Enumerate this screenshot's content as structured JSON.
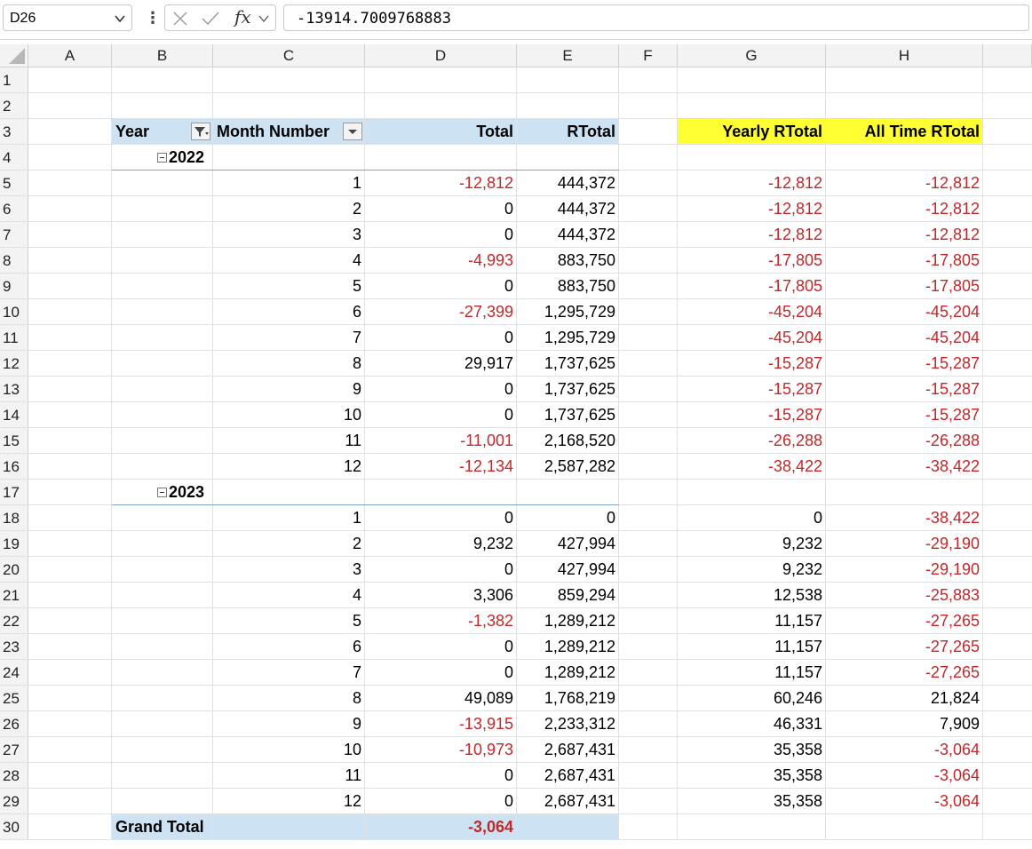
{
  "formula_bar": {
    "cell_ref": "D26",
    "formula": "-13914.7009768883",
    "more_icon": "vertical-ellipsis",
    "cancel_icon": "x-icon",
    "confirm_icon": "check-icon",
    "fx_label": "fx"
  },
  "columns": [
    "A",
    "B",
    "C",
    "D",
    "E",
    "F",
    "G",
    "H"
  ],
  "rows": [
    "1",
    "2",
    "3",
    "4",
    "5",
    "6",
    "7",
    "8",
    "9",
    "10",
    "11",
    "12",
    "13",
    "14",
    "15",
    "16",
    "17",
    "18",
    "19",
    "20",
    "21",
    "22",
    "23",
    "24",
    "25",
    "26",
    "27",
    "28",
    "29",
    "30"
  ],
  "pivot": {
    "header_year": "Year",
    "header_month": "Month Number",
    "header_total": "Total",
    "header_rtotal": "RTotal",
    "groups": [
      {
        "year": "2022",
        "rows": [
          {
            "month": "1",
            "total": "-12,812",
            "rtotal": "444,372",
            "neg": true
          },
          {
            "month": "2",
            "total": "0",
            "rtotal": "444,372",
            "neg": false
          },
          {
            "month": "3",
            "total": "0",
            "rtotal": "444,372",
            "neg": false
          },
          {
            "month": "4",
            "total": "-4,993",
            "rtotal": "883,750",
            "neg": true
          },
          {
            "month": "5",
            "total": "0",
            "rtotal": "883,750",
            "neg": false
          },
          {
            "month": "6",
            "total": "-27,399",
            "rtotal": "1,295,729",
            "neg": true
          },
          {
            "month": "7",
            "total": "0",
            "rtotal": "1,295,729",
            "neg": false
          },
          {
            "month": "8",
            "total": "29,917",
            "rtotal": "1,737,625",
            "neg": false
          },
          {
            "month": "9",
            "total": "0",
            "rtotal": "1,737,625",
            "neg": false
          },
          {
            "month": "10",
            "total": "0",
            "rtotal": "1,737,625",
            "neg": false
          },
          {
            "month": "11",
            "total": "-11,001",
            "rtotal": "2,168,520",
            "neg": true
          },
          {
            "month": "12",
            "total": "-12,134",
            "rtotal": "2,587,282",
            "neg": true
          }
        ]
      },
      {
        "year": "2023",
        "rows": [
          {
            "month": "1",
            "total": "0",
            "rtotal": "0",
            "neg": false
          },
          {
            "month": "2",
            "total": "9,232",
            "rtotal": "427,994",
            "neg": false
          },
          {
            "month": "3",
            "total": "0",
            "rtotal": "427,994",
            "neg": false
          },
          {
            "month": "4",
            "total": "3,306",
            "rtotal": "859,294",
            "neg": false
          },
          {
            "month": "5",
            "total": "-1,382",
            "rtotal": "1,289,212",
            "neg": true
          },
          {
            "month": "6",
            "total": "0",
            "rtotal": "1,289,212",
            "neg": false
          },
          {
            "month": "7",
            "total": "0",
            "rtotal": "1,289,212",
            "neg": false
          },
          {
            "month": "8",
            "total": "49,089",
            "rtotal": "1,768,219",
            "neg": false
          },
          {
            "month": "9",
            "total": "-13,915",
            "rtotal": "2,233,312",
            "neg": true
          },
          {
            "month": "10",
            "total": "-10,973",
            "rtotal": "2,687,431",
            "neg": true
          },
          {
            "month": "11",
            "total": "0",
            "rtotal": "2,687,431",
            "neg": false
          },
          {
            "month": "12",
            "total": "0",
            "rtotal": "2,687,431",
            "neg": false
          }
        ]
      }
    ],
    "grand_total_label": "Grand Total",
    "grand_total_value": "-3,064"
  },
  "side_table": {
    "header_yearly": "Yearly RTotal",
    "header_alltime": "All Time RTotal",
    "rows": [
      {
        "row": 5,
        "yearly": "-12,812",
        "alltime": "-12,812"
      },
      {
        "row": 6,
        "yearly": "-12,812",
        "alltime": "-12,812"
      },
      {
        "row": 7,
        "yearly": "-12,812",
        "alltime": "-12,812"
      },
      {
        "row": 8,
        "yearly": "-17,805",
        "alltime": "-17,805"
      },
      {
        "row": 9,
        "yearly": "-17,805",
        "alltime": "-17,805"
      },
      {
        "row": 10,
        "yearly": "-45,204",
        "alltime": "-45,204"
      },
      {
        "row": 11,
        "yearly": "-45,204",
        "alltime": "-45,204"
      },
      {
        "row": 12,
        "yearly": "-15,287",
        "alltime": "-15,287"
      },
      {
        "row": 13,
        "yearly": "-15,287",
        "alltime": "-15,287"
      },
      {
        "row": 14,
        "yearly": "-15,287",
        "alltime": "-15,287"
      },
      {
        "row": 15,
        "yearly": "-26,288",
        "alltime": "-26,288"
      },
      {
        "row": 16,
        "yearly": "-38,422",
        "alltime": "-38,422"
      },
      {
        "row": 18,
        "yearly": "0",
        "alltime": "-38,422"
      },
      {
        "row": 19,
        "yearly": "9,232",
        "alltime": "-29,190"
      },
      {
        "row": 20,
        "yearly": "9,232",
        "alltime": "-29,190"
      },
      {
        "row": 21,
        "yearly": "12,538",
        "alltime": "-25,883"
      },
      {
        "row": 22,
        "yearly": "11,157",
        "alltime": "-27,265"
      },
      {
        "row": 23,
        "yearly": "11,157",
        "alltime": "-27,265"
      },
      {
        "row": 24,
        "yearly": "11,157",
        "alltime": "-27,265"
      },
      {
        "row": 25,
        "yearly": "60,246",
        "alltime": "21,824"
      },
      {
        "row": 26,
        "yearly": "46,331",
        "alltime": "7,909"
      },
      {
        "row": 27,
        "yearly": "35,358",
        "alltime": "-3,064"
      },
      {
        "row": 28,
        "yearly": "35,358",
        "alltime": "-3,064"
      },
      {
        "row": 29,
        "yearly": "35,358",
        "alltime": "-3,064"
      }
    ]
  },
  "colors": {
    "negative": "#c0282a",
    "pivot_header": "#cde3f3",
    "highlight": "#ffff33"
  }
}
